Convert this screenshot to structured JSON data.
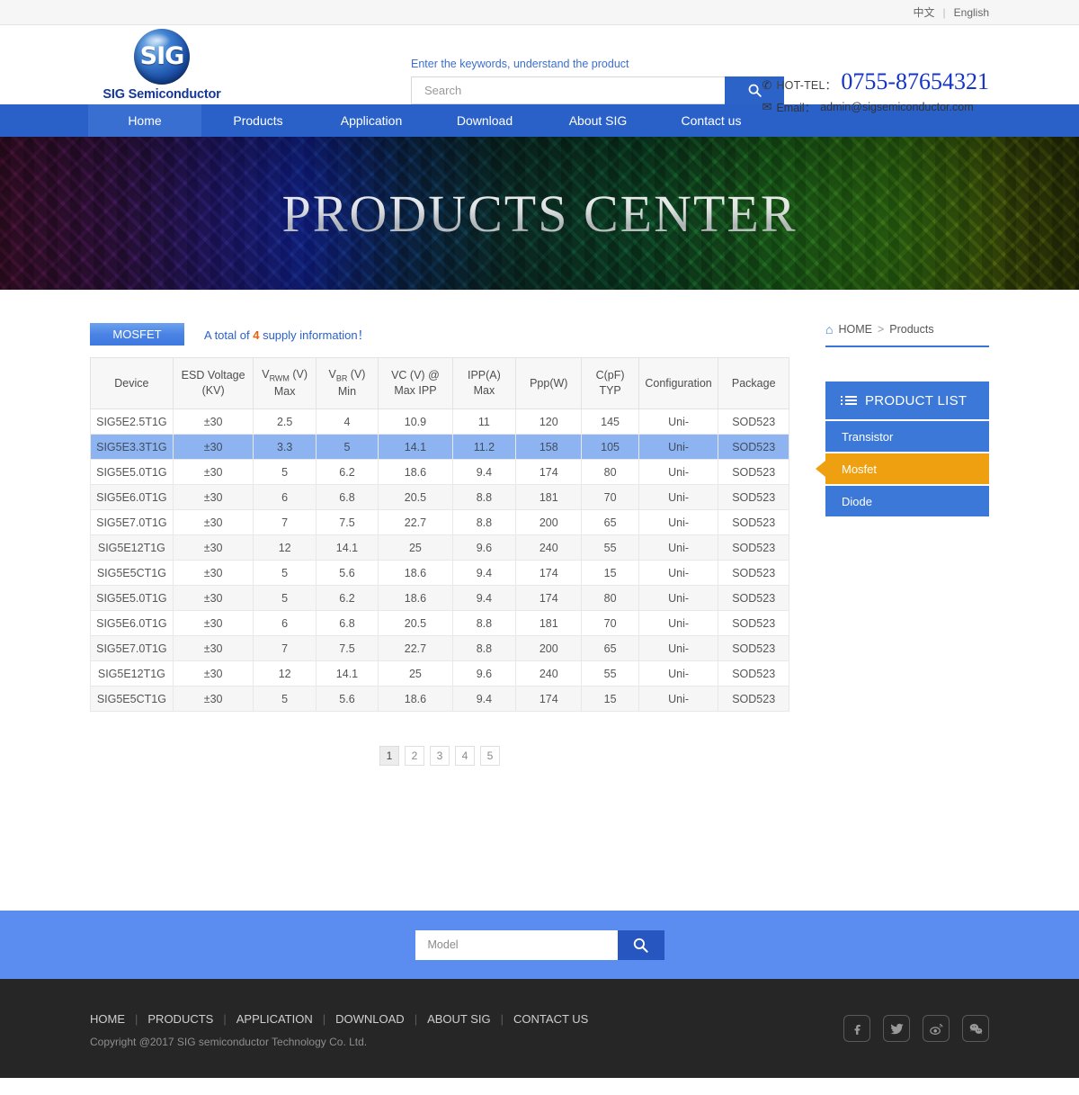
{
  "topbar": {
    "lang_cn": "中文",
    "separator": "|",
    "lang_en": "English"
  },
  "header": {
    "logo_mark": "SIG",
    "logo_text": "SIG Semiconductor",
    "search_hint": "Enter the keywords, understand the product",
    "search_placeholder": "Search",
    "search_value": "",
    "tel_label": "HOT-TEL：",
    "tel_number": "0755-87654321",
    "email_label": "Email：",
    "email_value": "admin@sigsemiconductor.com"
  },
  "nav": {
    "items": [
      {
        "label": "Home",
        "active": true
      },
      {
        "label": "Products",
        "active": false
      },
      {
        "label": "Application",
        "active": false
      },
      {
        "label": "Download",
        "active": false
      },
      {
        "label": "About SIG",
        "active": false
      },
      {
        "label": "Contact us",
        "active": false
      }
    ]
  },
  "banner": {
    "title": "PRODUCTS CENTER"
  },
  "breadcrumb": {
    "home": "HOME",
    "separator": ">",
    "current": "Products"
  },
  "product_list": {
    "heading": "PRODUCT LIST",
    "items": [
      {
        "label": "Transistor",
        "selected": false
      },
      {
        "label": "Mosfet",
        "selected": true
      },
      {
        "label": "Diode",
        "selected": false
      }
    ]
  },
  "catalog": {
    "tab_label": "MOSFET",
    "count_prefix": "A total of",
    "count_value": "4",
    "count_suffix": "supply information！"
  },
  "table": {
    "columns": [
      {
        "line1": "Device",
        "line2": ""
      },
      {
        "line1": "ESD Voltage",
        "line2": "(KV)"
      },
      {
        "line1": "V",
        "sub": "RWM",
        "line1b": " (V)",
        "line2": "Max"
      },
      {
        "line1": "V",
        "sub": "BR",
        "line1b": " (V)",
        "line2": "Min"
      },
      {
        "line1": "VC (V) @",
        "line2": "Max IPP"
      },
      {
        "line1": "IPP(A)",
        "line2": "Max"
      },
      {
        "line1": "Ppp(W)",
        "line2": ""
      },
      {
        "line1": "C(pF)",
        "line2": "TYP"
      },
      {
        "line1": "Configuration",
        "line2": ""
      },
      {
        "line1": "Package",
        "line2": ""
      }
    ],
    "rows": [
      {
        "cells": [
          "SIG5E2.5T1G",
          "±30",
          "2.5",
          "4",
          "10.9",
          "11",
          "120",
          "145",
          "Uni-",
          "SOD523"
        ],
        "highlighted": false
      },
      {
        "cells": [
          "SIG5E3.3T1G",
          "±30",
          "3.3",
          "5",
          "14.1",
          "11.2",
          "158",
          "105",
          "Uni-",
          "SOD523"
        ],
        "highlighted": true
      },
      {
        "cells": [
          "SIG5E5.0T1G",
          "±30",
          "5",
          "6.2",
          "18.6",
          "9.4",
          "174",
          "80",
          "Uni-",
          "SOD523"
        ],
        "highlighted": false
      },
      {
        "cells": [
          "SIG5E6.0T1G",
          "±30",
          "6",
          "6.8",
          "20.5",
          "8.8",
          "181",
          "70",
          "Uni-",
          "SOD523"
        ],
        "highlighted": false
      },
      {
        "cells": [
          "SIG5E7.0T1G",
          "±30",
          "7",
          "7.5",
          "22.7",
          "8.8",
          "200",
          "65",
          "Uni-",
          "SOD523"
        ],
        "highlighted": false
      },
      {
        "cells": [
          "SIG5E12T1G",
          "±30",
          "12",
          "14.1",
          "25",
          "9.6",
          "240",
          "55",
          "Uni-",
          "SOD523"
        ],
        "highlighted": false
      },
      {
        "cells": [
          "SIG5E5CT1G",
          "±30",
          "5",
          "5.6",
          "18.6",
          "9.4",
          "174",
          "15",
          "Uni-",
          "SOD523"
        ],
        "highlighted": false
      },
      {
        "cells": [
          "SIG5E5.0T1G",
          "±30",
          "5",
          "6.2",
          "18.6",
          "9.4",
          "174",
          "80",
          "Uni-",
          "SOD523"
        ],
        "highlighted": false
      },
      {
        "cells": [
          "SIG5E6.0T1G",
          "±30",
          "6",
          "6.8",
          "20.5",
          "8.8",
          "181",
          "70",
          "Uni-",
          "SOD523"
        ],
        "highlighted": false
      },
      {
        "cells": [
          "SIG5E7.0T1G",
          "±30",
          "7",
          "7.5",
          "22.7",
          "8.8",
          "200",
          "65",
          "Uni-",
          "SOD523"
        ],
        "highlighted": false
      },
      {
        "cells": [
          "SIG5E12T1G",
          "±30",
          "12",
          "14.1",
          "25",
          "9.6",
          "240",
          "55",
          "Uni-",
          "SOD523"
        ],
        "highlighted": false
      },
      {
        "cells": [
          "SIG5E5CT1G",
          "±30",
          "5",
          "5.6",
          "18.6",
          "9.4",
          "174",
          "15",
          "Uni-",
          "SOD523"
        ],
        "highlighted": false
      }
    ]
  },
  "pagination": {
    "pages": [
      "1",
      "2",
      "3",
      "4",
      "5"
    ],
    "active": "1"
  },
  "bottom_search": {
    "placeholder": "Model",
    "value": ""
  },
  "footer": {
    "links": [
      "HOME",
      "PRODUCTS",
      "APPLICATION",
      "DOWNLOAD",
      "ABOUT SIG",
      "CONTACT US"
    ],
    "copyright": "Copyright @2017  SIG semiconductor Technology Co. Ltd.",
    "socials": [
      "facebook-icon",
      "twitter-icon",
      "weibo-icon",
      "wechat-icon"
    ]
  },
  "colors": {
    "brand_blue": "#2a61c9",
    "nav_blue": "#3b78d8",
    "accent_orange": "#efa010",
    "count_orange": "#e8620c",
    "row_highlight": "#8db4f0",
    "bottom_band": "#5b8cf0",
    "footer_dark": "#262626"
  }
}
